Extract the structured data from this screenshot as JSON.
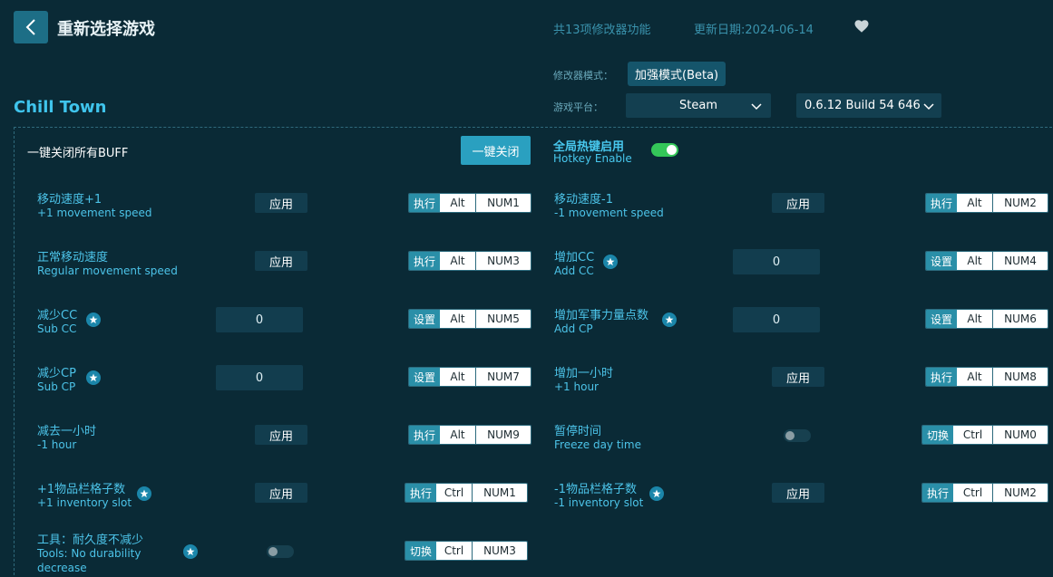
{
  "header": {
    "title": "重新选择游戏",
    "feature_count": "共13项修改器功能",
    "update_date": "更新日期:2024-06-14"
  },
  "mode": {
    "label": "修改器模式：",
    "value": "加强模式(Beta)"
  },
  "platform": {
    "label": "游戏平台：",
    "value": "Steam",
    "version": "0.6.12 Build 54 646"
  },
  "game": {
    "title": "Chill Town"
  },
  "controls": {
    "all_buff_label": "一键关闭所有BUFF",
    "all_buff_button": "一键关闭",
    "hotkey_cn": "全局热键启用",
    "hotkey_en": "Hotkey Enable",
    "hotkey_enabled": true
  },
  "features": [
    {
      "name": "移动速度+1",
      "sub": "+1 movement speed",
      "control": "apply",
      "button": "应用",
      "star": false,
      "action": "执行",
      "mod": "Alt",
      "key": "NUM1"
    },
    {
      "name": "移动速度-1",
      "sub": "-1 movement speed",
      "control": "apply",
      "button": "应用",
      "star": false,
      "action": "执行",
      "mod": "Alt",
      "key": "NUM2"
    },
    {
      "name": "正常移动速度",
      "sub": "Regular movement speed",
      "control": "apply",
      "button": "应用",
      "star": false,
      "action": "执行",
      "mod": "Alt",
      "key": "NUM3"
    },
    {
      "name": "增加CC",
      "sub": "Add CC",
      "control": "input",
      "value": "0",
      "star": true,
      "action": "设置",
      "mod": "Alt",
      "key": "NUM4"
    },
    {
      "name": "减少CC",
      "sub": "Sub CC",
      "control": "input",
      "value": "0",
      "star": true,
      "action": "设置",
      "mod": "Alt",
      "key": "NUM5"
    },
    {
      "name": "增加军事力量点数",
      "sub": "Add CP",
      "control": "input",
      "value": "0",
      "star": true,
      "action": "设置",
      "mod": "Alt",
      "key": "NUM6"
    },
    {
      "name": "减少CP",
      "sub": "Sub CP",
      "control": "input",
      "value": "0",
      "star": true,
      "action": "设置",
      "mod": "Alt",
      "key": "NUM7"
    },
    {
      "name": "增加一小时",
      "sub": "+1 hour",
      "control": "apply",
      "button": "应用",
      "star": false,
      "action": "执行",
      "mod": "Alt",
      "key": "NUM8"
    },
    {
      "name": "减去一小时",
      "sub": "-1 hour",
      "control": "apply",
      "button": "应用",
      "star": false,
      "action": "执行",
      "mod": "Alt",
      "key": "NUM9"
    },
    {
      "name": "暂停时间",
      "sub": "Freeze day time",
      "control": "toggle",
      "star": false,
      "action": "切换",
      "mod": "Ctrl",
      "key": "NUM0"
    },
    {
      "name": "+1物品栏格子数",
      "sub": "+1 inventory slot",
      "control": "apply",
      "button": "应用",
      "star": true,
      "action": "执行",
      "mod": "Ctrl",
      "key": "NUM1"
    },
    {
      "name": "-1物品栏格子数",
      "sub": "-1 inventory slot",
      "control": "apply",
      "button": "应用",
      "star": true,
      "action": "执行",
      "mod": "Ctrl",
      "key": "NUM2"
    },
    {
      "name": "工具：耐久度不减少",
      "sub": "Tools: No durability",
      "sub2": "decrease",
      "control": "toggle",
      "star": true,
      "action": "切换",
      "mod": "Ctrl",
      "key": "NUM3"
    }
  ],
  "colors": {
    "background": "#0a2a36",
    "accent": "#3fc4ec",
    "toggle_on": "#34c759"
  }
}
